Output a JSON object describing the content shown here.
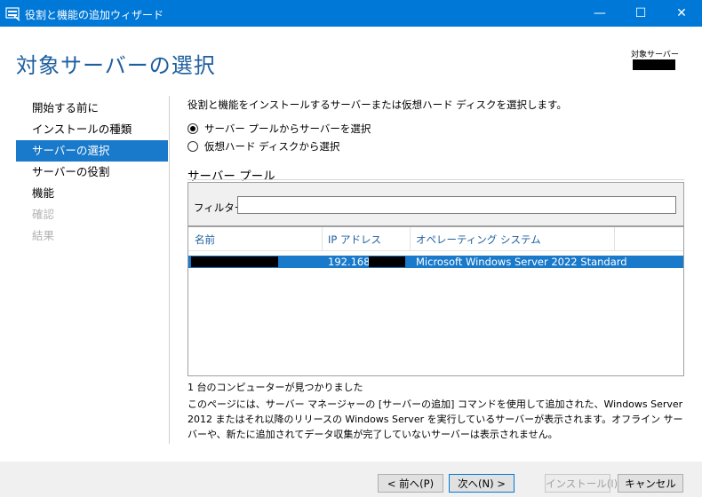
{
  "window": {
    "title": "役割と機能の追加ウィザード",
    "minimize": "—",
    "maximize": "☐",
    "close": "✕"
  },
  "header": {
    "title": "対象サーバーの選択",
    "destination_label": "対象サーバー"
  },
  "nav": {
    "items": [
      {
        "label": "開始する前に",
        "state": "normal"
      },
      {
        "label": "インストールの種類",
        "state": "normal"
      },
      {
        "label": "サーバーの選択",
        "state": "active"
      },
      {
        "label": "サーバーの役割",
        "state": "normal"
      },
      {
        "label": "機能",
        "state": "normal"
      },
      {
        "label": "確認",
        "state": "disabled"
      },
      {
        "label": "結果",
        "state": "disabled"
      }
    ]
  },
  "main": {
    "instruction": "役割と機能をインストールするサーバーまたは仮想ハード ディスクを選択します。",
    "options": [
      {
        "label": "サーバー プールからサーバーを選択",
        "checked": true
      },
      {
        "label": "仮想ハード ディスクから選択",
        "checked": false
      }
    ],
    "pool_title": "サーバー プール",
    "filter_label": "フィルター:",
    "filter_value": "",
    "columns": [
      "名前",
      "IP アドレス",
      "オペレーティング システム"
    ],
    "rows": [
      {
        "name": "",
        "ip": "192.168.",
        "os": "Microsoft Windows Server 2022 Standard",
        "selected": true
      }
    ],
    "found_text": "1 台のコンピューターが見つかりました",
    "description": "このページには、サーバー マネージャーの [サーバーの追加] コマンドを使用して追加された、Windows Server 2012 またはそれ以降のリリースの Windows Server を実行しているサーバーが表示されます。オフライン サーバーや、新たに追加されてデータ収集が完了していないサーバーは表示されません。"
  },
  "footer": {
    "prev": "< 前へ(P)",
    "next": "次へ(N) >",
    "install": "インストール(I)",
    "cancel": "キャンセル"
  },
  "colors": {
    "titlebar": "#0078d7",
    "accent": "#1979ca",
    "header_text": "#1e5f9f"
  }
}
